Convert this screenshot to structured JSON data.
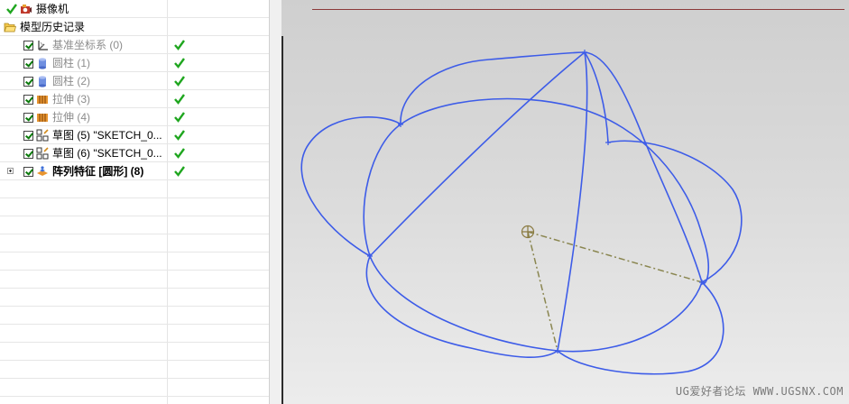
{
  "tree": {
    "rows": [
      {
        "label": "摄像机",
        "icon": "camera-icon",
        "style": "normal"
      },
      {
        "label": "模型历史记录",
        "icon": "folder-open-icon",
        "style": "normal"
      },
      {
        "label": "基准坐标系 (0)",
        "icon": "datum-csys-icon",
        "style": "dim"
      },
      {
        "label": "圆柱 (1)",
        "icon": "cylinder-icon",
        "style": "dim"
      },
      {
        "label": "圆柱 (2)",
        "icon": "cylinder-icon",
        "style": "dim"
      },
      {
        "label": "拉伸 (3)",
        "icon": "extrude-icon",
        "style": "dim"
      },
      {
        "label": "拉伸 (4)",
        "icon": "extrude-icon",
        "style": "dim"
      },
      {
        "label": "草图 (5) \"SKETCH_0...",
        "icon": "sketch-icon",
        "style": "normal"
      },
      {
        "label": "草图 (6) \"SKETCH_0...",
        "icon": "sketch-icon",
        "style": "normal"
      },
      {
        "label": "阵列特征 [圆形] (8)",
        "icon": "pattern-feature-icon",
        "style": "bold"
      }
    ]
  },
  "colors": {
    "curve": "#3d5ce8",
    "axis": "#8a8650",
    "check_green": "#1fa61f"
  },
  "watermark": "UG爱好者论坛 WWW.UGSNX.COM"
}
